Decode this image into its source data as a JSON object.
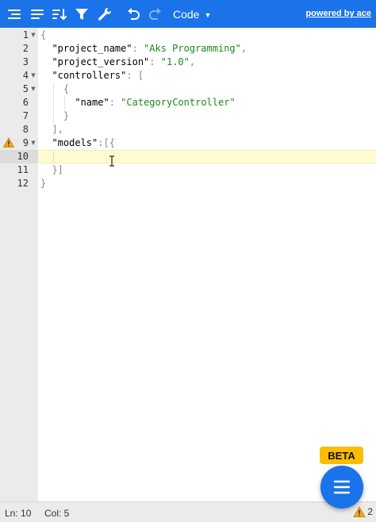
{
  "toolbar": {
    "icons": [
      "format-icon",
      "compact-icon",
      "sort-icon",
      "filter-icon",
      "repair-icon",
      "undo-icon",
      "redo-icon"
    ],
    "mode_label": "Code",
    "powered_by": "powered by ace"
  },
  "editor": {
    "line_numbers": [
      "1",
      "2",
      "3",
      "4",
      "5",
      "6",
      "7",
      "8",
      "9",
      "10",
      "11",
      "12"
    ],
    "lines": [
      "{",
      "  \"project_name\": \"Aks Programming\",",
      "  \"project_version\": \"1.0\",",
      "  \"controllers\": [",
      "    {",
      "      \"name\": \"CategoryController\"",
      "    }",
      "  ],",
      "  \"models\":[{",
      "",
      "  }]",
      "}"
    ],
    "tokens": {
      "brace_open": "{",
      "brace_close": "}",
      "key_project_name": "\"project_name\"",
      "val_project_name": "\"Aks Programming\"",
      "key_project_version": "\"project_version\"",
      "val_project_version": "\"1.0\"",
      "key_controllers": "\"controllers\"",
      "key_name": "\"name\"",
      "val_name": "\"CategoryController\"",
      "key_models": "\"models\"",
      "bracket_close_comma": "],",
      "models_open": "[{",
      "models_close": "}]",
      "colon": ": ",
      "colon_tight": ":",
      "comma": ",",
      "bracket_open": "["
    },
    "active_line": 10,
    "warning_line": 9
  },
  "status": {
    "line": "Ln: 10",
    "col": "Col: 5",
    "warning_count": "2"
  },
  "beta_label": "BETA",
  "colors": {
    "toolbar": "#1a73e8",
    "string": "#1a8a1a",
    "beta": "#fbbc04",
    "active_line": "#fffbd1"
  }
}
